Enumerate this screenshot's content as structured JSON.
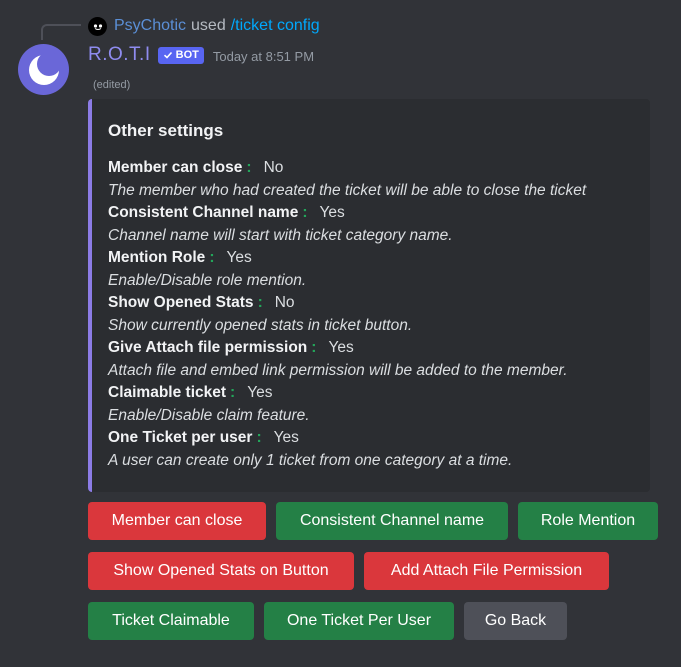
{
  "reply": {
    "user": "PsyChotic",
    "used_text": "used",
    "command": "/ticket config"
  },
  "author": {
    "name": "R.O.T.I",
    "bot_tag": "BOT",
    "timestamp": "Today at 8:51 PM",
    "edited": "(edited)"
  },
  "embed": {
    "color": "#8c7ce6",
    "title": "Other settings",
    "fields": [
      {
        "name": "Member can close",
        "value": "No",
        "desc": "The member who had created the ticket will be able to close the ticket"
      },
      {
        "name": "Consistent Channel name",
        "value": "Yes",
        "desc": "Channel name will start with ticket category name."
      },
      {
        "name": "Mention Role",
        "value": "Yes",
        "desc": "Enable/Disable role mention."
      },
      {
        "name": "Show Opened Stats",
        "value": "No",
        "desc": "Show currently opened stats in ticket button."
      },
      {
        "name": "Give Attach file permission",
        "value": "Yes",
        "desc": "Attach file and embed link permission will be added to the member."
      },
      {
        "name": "Claimable ticket",
        "value": "Yes",
        "desc": "Enable/Disable claim feature."
      },
      {
        "name": "One Ticket per user",
        "value": "Yes",
        "desc": "A user can create only 1 ticket from one category at a time."
      }
    ]
  },
  "buttons": {
    "member_can_close": "Member can close",
    "consistent_channel_name": "Consistent Channel name",
    "role_mention": "Role Mention",
    "show_opened_stats": "Show Opened Stats on Button",
    "add_attach_file": "Add Attach File Permission",
    "ticket_claimable": "Ticket Claimable",
    "one_ticket_per_user": "One Ticket Per User",
    "go_back": "Go Back"
  },
  "colors": {
    "background": "#313338",
    "red": "#da373c",
    "green": "#248046",
    "grey": "#4e5058",
    "bot_tag": "#5865f2"
  }
}
